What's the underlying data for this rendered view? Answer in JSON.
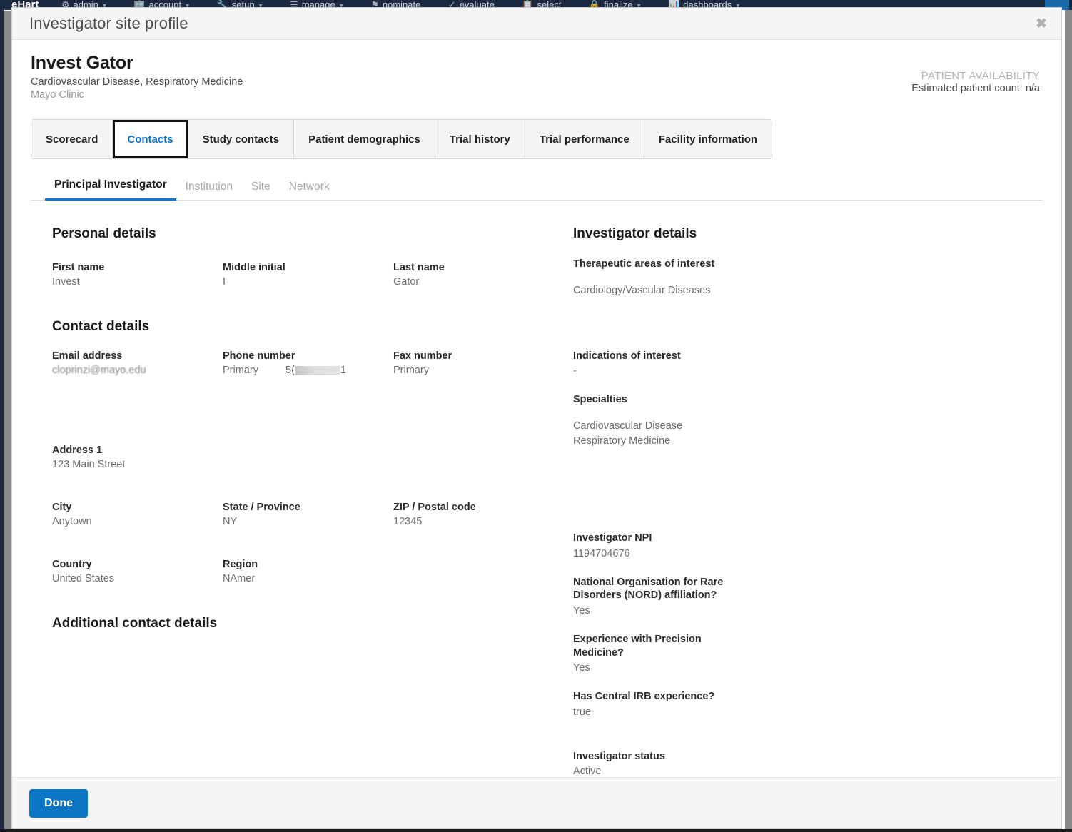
{
  "app_nav": {
    "brand": "eHart",
    "items": [
      {
        "label": "admin",
        "caret": "⌄"
      },
      {
        "label": "account",
        "caret": "⌄"
      },
      {
        "label": "setup",
        "caret": "⌄"
      },
      {
        "label": "manage",
        "caret": "⌄"
      },
      {
        "label": "nominate",
        "caret": ""
      },
      {
        "label": "evaluate",
        "caret": ""
      },
      {
        "label": "select",
        "caret": ""
      },
      {
        "label": "finalize",
        "caret": "⌄"
      },
      {
        "label": "dashboards",
        "caret": "⌄"
      }
    ]
  },
  "modal": {
    "title": "Investigator site profile",
    "close_icon": "close-icon",
    "close_glyph": "✖"
  },
  "profile": {
    "name": "Invest Gator",
    "specialties_line": "Cardiovascular Disease, Respiratory Medicine",
    "organization": "Mayo Clinic",
    "availability_label": "PATIENT AVAILABILITY",
    "availability_value": "Estimated patient count: n/a"
  },
  "tabs": [
    {
      "label": "Scorecard",
      "active": false
    },
    {
      "label": "Contacts",
      "active": true
    },
    {
      "label": "Study contacts",
      "active": false
    },
    {
      "label": "Patient demographics",
      "active": false
    },
    {
      "label": "Trial history",
      "active": false
    },
    {
      "label": "Trial performance",
      "active": false
    },
    {
      "label": "Facility information",
      "active": false
    }
  ],
  "subtabs": [
    {
      "label": "Principal Investigator",
      "active": true
    },
    {
      "label": "Institution",
      "active": false
    },
    {
      "label": "Site",
      "active": false
    },
    {
      "label": "Network",
      "active": false
    }
  ],
  "left_column": {
    "personal_details": {
      "title": "Personal details",
      "first_name": {
        "label": "First name",
        "value": "Invest"
      },
      "middle_initial": {
        "label": "Middle initial",
        "value": "I"
      },
      "last_name": {
        "label": "Last name",
        "value": "Gator"
      }
    },
    "contact_details": {
      "title": "Contact details",
      "email": {
        "label": "Email address",
        "value": "cloprinzi@mayo.edu"
      },
      "phone": {
        "label": "Phone number",
        "kind": "Primary",
        "prefix": "5(",
        "suffix": "1"
      },
      "fax": {
        "label": "Fax number",
        "kind": "Primary"
      }
    },
    "address": {
      "address1": {
        "label": "Address 1",
        "value": "123 Main Street"
      },
      "city": {
        "label": "City",
        "value": "Anytown"
      },
      "state": {
        "label": "State / Province",
        "value": "NY"
      },
      "zip": {
        "label": "ZIP / Postal code",
        "value": "12345"
      },
      "country": {
        "label": "Country",
        "value": "United States"
      },
      "region": {
        "label": "Region",
        "value": "NAmer"
      }
    },
    "additional_contact_details": {
      "title": "Additional contact details"
    }
  },
  "right_column": {
    "title": "Investigator details",
    "therapeutic_areas": {
      "label": "Therapeutic areas of interest",
      "value": "Cardiology/Vascular Diseases"
    },
    "indications": {
      "label": "Indications of interest",
      "value": "-"
    },
    "specialties": {
      "label": "Specialties",
      "value_line1": "Cardiovascular Disease",
      "value_line2": "Respiratory Medicine"
    },
    "npi": {
      "label": "Investigator NPI",
      "value": "1194704676"
    },
    "nord": {
      "label": "National Organisation for Rare Disorders (NORD) affiliation?",
      "value": "Yes"
    },
    "precision_medicine": {
      "label": "Experience with Precision Medicine?",
      "value": "Yes"
    },
    "central_irb": {
      "label": "Has Central IRB experience?",
      "value": "true"
    },
    "status": {
      "label": "Investigator status",
      "value": "Active"
    }
  },
  "footer": {
    "done_label": "Done"
  },
  "colors": {
    "accent_blue": "#0b76c4",
    "tab_active_text": "#0a71c8",
    "subtab_underline": "#0a76d0",
    "navbar": "#1b2a41",
    "header_bg": "#f5f5f5"
  }
}
